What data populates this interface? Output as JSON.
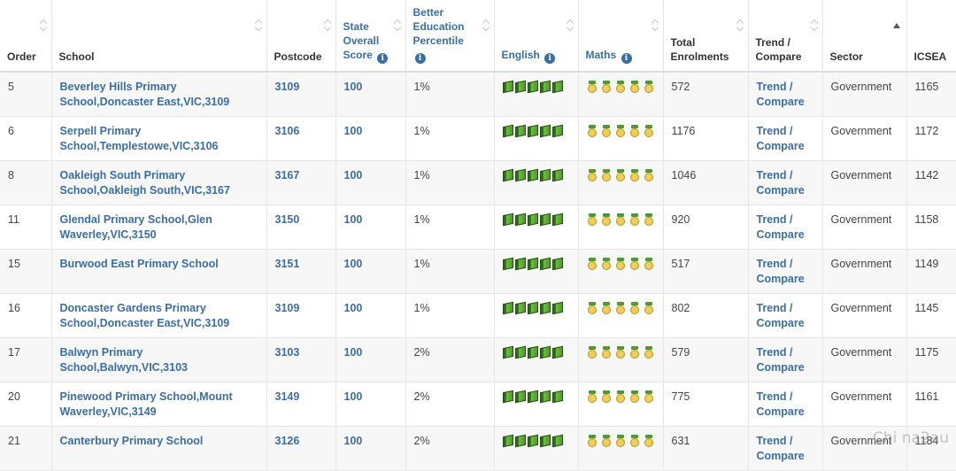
{
  "columns": {
    "order": "Order",
    "school": "School",
    "postcode": "Postcode",
    "state_score_l1": "State",
    "state_score_l2": "Overall",
    "state_score_l3": "Score",
    "percentile_l1": "Better",
    "percentile_l2": "Education",
    "percentile_l3": "Percentile",
    "english": "English",
    "maths": "Maths",
    "enrol_l1": "Total",
    "enrol_l2": "Enrolments",
    "trend_l1": "Trend /",
    "trend_l2": "Compare",
    "sector": "Sector",
    "icsea": "ICSEA"
  },
  "info_glyph": "i",
  "rows": [
    {
      "order": "5",
      "school": "Beverley Hills Primary School,Doncaster East,VIC,3109",
      "postcode": "3109",
      "score": "100",
      "percentile": "1%",
      "english_rating": 5,
      "maths_rating": 5,
      "enrolments": "572",
      "trend_l1": "Trend /",
      "trend_l2": "Compare",
      "sector": "Government",
      "icsea": "1165"
    },
    {
      "order": "6",
      "school": "Serpell Primary School,Templestowe,VIC,3106",
      "postcode": "3106",
      "score": "100",
      "percentile": "1%",
      "english_rating": 5,
      "maths_rating": 5,
      "enrolments": "1176",
      "trend_l1": "Trend /",
      "trend_l2": "Compare",
      "sector": "Government",
      "icsea": "1172"
    },
    {
      "order": "8",
      "school": "Oakleigh South Primary School,Oakleigh South,VIC,3167",
      "postcode": "3167",
      "score": "100",
      "percentile": "1%",
      "english_rating": 5,
      "maths_rating": 5,
      "enrolments": "1046",
      "trend_l1": "Trend /",
      "trend_l2": "Compare",
      "sector": "Government",
      "icsea": "1142"
    },
    {
      "order": "11",
      "school": "Glendal Primary School,Glen Waverley,VIC,3150",
      "postcode": "3150",
      "score": "100",
      "percentile": "1%",
      "english_rating": 5,
      "maths_rating": 5,
      "enrolments": "920",
      "trend_l1": "Trend /",
      "trend_l2": "Compare",
      "sector": "Government",
      "icsea": "1158"
    },
    {
      "order": "15",
      "school": "Burwood East Primary School",
      "postcode": "3151",
      "score": "100",
      "percentile": "1%",
      "english_rating": 5,
      "maths_rating": 5,
      "enrolments": "517",
      "trend_l1": "Trend /",
      "trend_l2": "Compare",
      "sector": "Government",
      "icsea": "1149"
    },
    {
      "order": "16",
      "school": "Doncaster Gardens Primary School,Doncaster East,VIC,3109",
      "postcode": "3109",
      "score": "100",
      "percentile": "1%",
      "english_rating": 5,
      "maths_rating": 5,
      "enrolments": "802",
      "trend_l1": "Trend /",
      "trend_l2": "Compare",
      "sector": "Government",
      "icsea": "1145"
    },
    {
      "order": "17",
      "school": "Balwyn Primary School,Balwyn,VIC,3103",
      "postcode": "3103",
      "score": "100",
      "percentile": "2%",
      "english_rating": 5,
      "maths_rating": 5,
      "enrolments": "579",
      "trend_l1": "Trend /",
      "trend_l2": "Compare",
      "sector": "Government",
      "icsea": "1175"
    },
    {
      "order": "20",
      "school": "Pinewood Primary School,Mount Waverley,VIC,3149",
      "postcode": "3149",
      "score": "100",
      "percentile": "2%",
      "english_rating": 5,
      "maths_rating": 5,
      "enrolments": "775",
      "trend_l1": "Trend /",
      "trend_l2": "Compare",
      "sector": "Government",
      "icsea": "1161"
    },
    {
      "order": "21",
      "school": "Canterbury Primary School",
      "postcode": "3126",
      "score": "100",
      "percentile": "2%",
      "english_rating": 5,
      "maths_rating": 5,
      "enrolments": "631",
      "trend_l1": "Trend /",
      "trend_l2": "Compare",
      "sector": "Government",
      "icsea": "1184"
    }
  ],
  "icons": {
    "english": "book-icon",
    "maths": "medal-icon"
  },
  "colors": {
    "link": "#3a6ea5",
    "row_alt": "#f7f7f7",
    "book_green": "#4f9a2a",
    "medal_gold": "#f0cf55"
  },
  "watermark": "Chi na2au"
}
